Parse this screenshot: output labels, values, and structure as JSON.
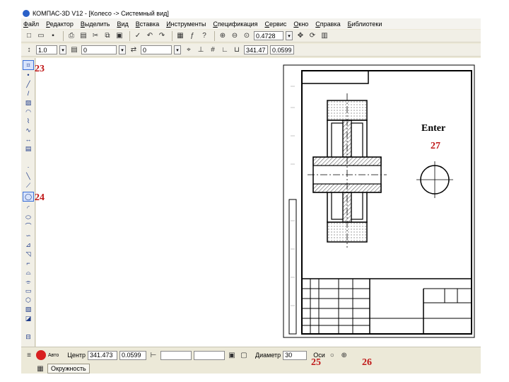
{
  "window": {
    "title": "КОМПАС-3D V12 - [Колесо -> Системный вид]"
  },
  "menu": [
    "Файл",
    "Редактор",
    "Выделить",
    "Вид",
    "Вставка",
    "Инструменты",
    "Спецификация",
    "Сервис",
    "Окно",
    "Справка",
    "Библиотеки"
  ],
  "toolbar1": {
    "zoom_value": "0.4728"
  },
  "toolbar2": {
    "line_step": "1.0",
    "layer": "0",
    "style_value": "0",
    "coord_x": "341.47",
    "coord_y": "0.0599"
  },
  "properties": {
    "auto_label": "Авто",
    "center_label": "Центр",
    "center_x": "341.473",
    "center_y": "0.0599",
    "diameter_label": "Диаметр",
    "diameter_value": "30",
    "axes_label": "Оси"
  },
  "status": {
    "tab_label": "Окружность"
  },
  "annotations": {
    "c23": "23",
    "c24": "24",
    "c25": "25",
    "c26": "26",
    "c27": "27",
    "enter": "Enter"
  },
  "colors": {
    "callout": "#c01818",
    "hatch": "#404040",
    "window_bg": "#ece9d8"
  }
}
